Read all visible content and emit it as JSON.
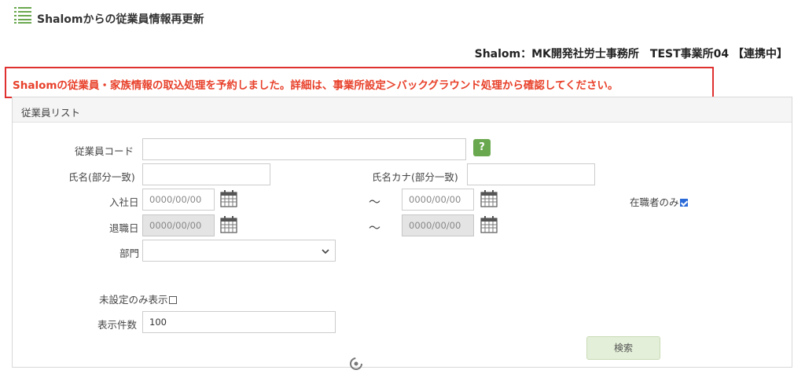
{
  "header": {
    "title": "Shalomからの従業員情報再更新",
    "menu_icon": "list-icon"
  },
  "office": {
    "label": "Shalom：MK開発社労士事務所　TEST事業所04 【連携中】"
  },
  "notice": {
    "text": "Shalomの従業員・家族情報の取込処理を予約しました。詳細は、事業所設定＞バックグラウンド処理から確認してください。",
    "color": "#e8402a",
    "border_color": "#e03030"
  },
  "panel": {
    "title": "従業員リスト"
  },
  "form": {
    "employee_code": {
      "label": "従業員コード",
      "value": "",
      "help": "?"
    },
    "name": {
      "label": "氏名(部分一致)",
      "value": ""
    },
    "name_kana": {
      "label": "氏名カナ(部分一致)",
      "value": ""
    },
    "hire_date": {
      "label": "入社日",
      "from_placeholder": "0000/00/00",
      "to_placeholder": "0000/00/00",
      "separator": "～"
    },
    "retire_date": {
      "label": "退職日",
      "from_placeholder": "0000/00/00",
      "to_placeholder": "0000/00/00",
      "separator": "～"
    },
    "active_only": {
      "label": "在職者のみ",
      "checked": true
    },
    "department": {
      "label": "部門",
      "value": ""
    },
    "unset_only": {
      "label": "未設定のみ表示",
      "checked": false
    },
    "page_size": {
      "label": "表示件数",
      "value": "100"
    },
    "search_button": "検索"
  },
  "colors": {
    "accent_green": "#6aa84f",
    "search_button_bg": "#e3efd8"
  }
}
